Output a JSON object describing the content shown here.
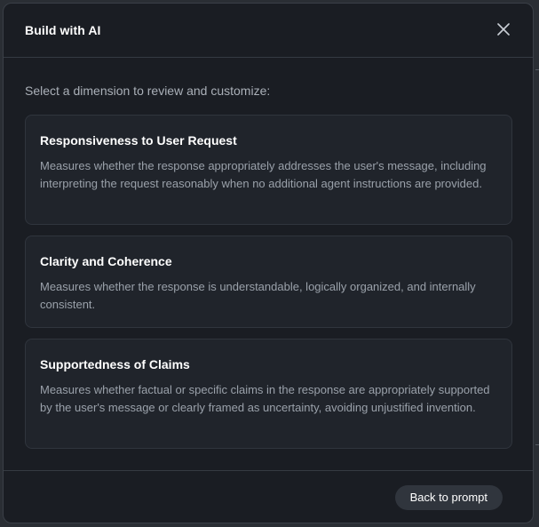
{
  "modal": {
    "title": "Build with AI",
    "close_icon": "close-icon"
  },
  "body": {
    "instruction": "Select a dimension to review and customize:",
    "dimensions": [
      {
        "title": "Responsiveness to User Request",
        "description": "Measures whether the response appropriately addresses the user's message, including interpreting the request reasonably when no additional agent instructions are provided."
      },
      {
        "title": "Clarity and Coherence",
        "description": "Measures whether the response is understandable, logically organized, and internally consistent."
      },
      {
        "title": "Supportedness of Claims",
        "description": "Measures whether factual or specific claims in the response are appropriately supported by the user's message or clearly framed as uncertainty, avoiding unjustified invention."
      }
    ]
  },
  "footer": {
    "back_label": "Back to prompt"
  },
  "colors": {
    "modal_bg": "#1a1d23",
    "card_bg": "#20242b",
    "button_bg": "#30353d",
    "title_text": "#ffffff",
    "muted_text": "#9aa1aa"
  }
}
